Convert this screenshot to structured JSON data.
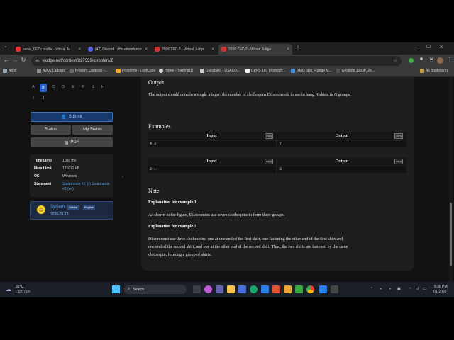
{
  "browser": {
    "tabs": [
      {
        "title": "sadat_007's profile - Virtual Ju",
        "fav": "#d33"
      },
      {
        "title": "(42) Discord | #tfc-attendance",
        "fav": "#5865f2"
      },
      {
        "title": "2026 TFC-3 - Virtual Judge",
        "fav": "#c33"
      },
      {
        "title": "2026 TFC-3 - Virtual Judge",
        "fav": "#c33"
      }
    ],
    "url": "vjudge.net/contest/827399#problem/B",
    "bookmarks": [
      {
        "label": "Apps"
      },
      {
        "label": "A2OJ Ladders"
      },
      {
        "label": "Present Contests -..."
      },
      {
        "label": "Problems - LeetCode"
      },
      {
        "label": "Home - TorrentBD"
      },
      {
        "label": "Divisibility - USACO..."
      },
      {
        "label": "CPPS 101 | fortnigh..."
      },
      {
        "label": "RMQ task (Range M..."
      },
      {
        "label": "Desktop 1080P, 2K..."
      },
      {
        "label": "All Bookmarks"
      }
    ]
  },
  "sidebar": {
    "problems": [
      "A",
      "B",
      "C",
      "D",
      "E",
      "F",
      "G",
      "H",
      "I",
      "J"
    ],
    "submit": "Submit",
    "status": "Status",
    "my_status": "My Status",
    "pdf": "PDF",
    "info": [
      {
        "k": "Time Limit",
        "v": "1000 ms"
      },
      {
        "k": "Mem Limit",
        "v": "131072 kB"
      },
      {
        "k": "OS",
        "v": "Windows"
      },
      {
        "k": "Statement",
        "v": "Statements #1 (p) Statements #2 (en)"
      }
    ],
    "system_name": "System",
    "badge_official": "Official",
    "badge_english": "English",
    "system_date": "2026-06-13"
  },
  "problem": {
    "output_heading": "Output",
    "output_text": "The output should contain a single integer: the number of clothespins Dilson needs to use to hang N shirts in G groups.",
    "examples_heading": "Examples",
    "col_input": "Input",
    "col_output": "Output",
    "copy": "copy",
    "examples": [
      {
        "input": "4 3",
        "output": "7"
      },
      {
        "input": "2 1",
        "output": "3"
      }
    ],
    "note_heading": "Note",
    "note1_title": "Explanation for example 1",
    "note1_text": "As shown in the figure, Dilson must use seven clothespins to form three groups.",
    "note2_title": "Explanation for example 2",
    "note2_line1": "Dilson must use three clothespins: one at one end of the first shirt, one fastening the other end of the first shirt and",
    "note2_line2": "one end of the second shirt, and one at the other end of the second shirt. Thus, the two shirts are fastened by the same",
    "note2_line3": "clothespin, forming a group of shirts."
  },
  "taskbar": {
    "weather_temp": "31°C",
    "weather_desc": "Light rain",
    "search": "Search",
    "time": "5:38 PM",
    "date": "7/1/2026"
  }
}
